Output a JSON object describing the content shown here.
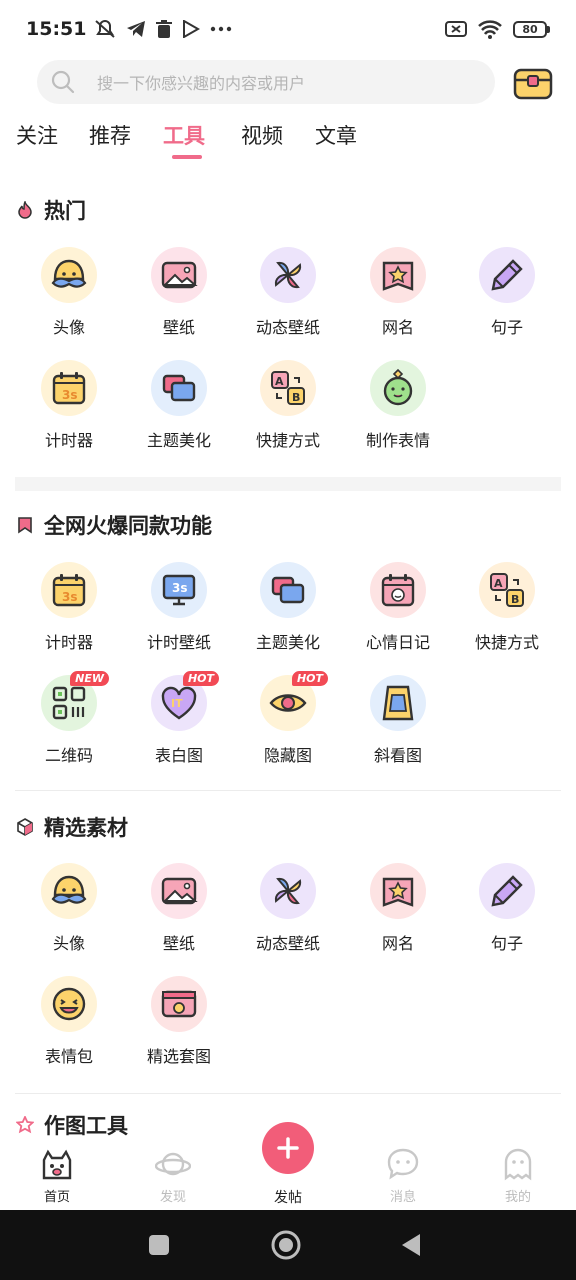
{
  "status_bar": {
    "time": "15:51",
    "battery": "80"
  },
  "search": {
    "placeholder": "搜一下你感兴趣的内容或用户"
  },
  "tabs": [
    {
      "label": "关注"
    },
    {
      "label": "推荐"
    },
    {
      "label": "工具",
      "active": true
    },
    {
      "label": "视频"
    },
    {
      "label": "文章"
    }
  ],
  "sections": {
    "hot": {
      "title": "热门",
      "items": [
        {
          "label": "头像",
          "icon": "mustache-face-icon"
        },
        {
          "label": "壁纸",
          "icon": "picture-icon"
        },
        {
          "label": "动态壁纸",
          "icon": "pinwheel-icon"
        },
        {
          "label": "网名",
          "icon": "star-card-icon"
        },
        {
          "label": "句子",
          "icon": "pencil-icon"
        },
        {
          "label": "计时器",
          "icon": "calendar-3s-icon"
        },
        {
          "label": "主题美化",
          "icon": "layers-icon"
        },
        {
          "label": "快捷方式",
          "icon": "ab-swap-icon"
        },
        {
          "label": "制作表情",
          "icon": "emoji-maker-icon"
        }
      ]
    },
    "viral": {
      "title": "全网火爆同款功能",
      "items": [
        {
          "label": "计时器",
          "icon": "calendar-3s-icon"
        },
        {
          "label": "计时壁纸",
          "icon": "monitor-3s-icon"
        },
        {
          "label": "主题美化",
          "icon": "layers-icon"
        },
        {
          "label": "心情日记",
          "icon": "mood-calendar-icon"
        },
        {
          "label": "快捷方式",
          "icon": "ab-swap-icon"
        },
        {
          "label": "二维码",
          "icon": "qrcode-icon",
          "badge": "NEW"
        },
        {
          "label": "表白图",
          "icon": "heart-letter-icon",
          "badge": "HOT"
        },
        {
          "label": "隐藏图",
          "icon": "eye-icon",
          "badge": "HOT"
        },
        {
          "label": "斜看图",
          "icon": "tilted-card-icon"
        }
      ]
    },
    "materials": {
      "title": "精选素材",
      "items": [
        {
          "label": "头像",
          "icon": "mustache-face-icon"
        },
        {
          "label": "壁纸",
          "icon": "picture-icon"
        },
        {
          "label": "动态壁纸",
          "icon": "pinwheel-icon"
        },
        {
          "label": "网名",
          "icon": "star-card-icon"
        },
        {
          "label": "句子",
          "icon": "pencil-icon"
        },
        {
          "label": "表情包",
          "icon": "laughing-face-icon"
        },
        {
          "label": "精选套图",
          "icon": "photo-frame-icon"
        }
      ]
    },
    "tools": {
      "title": "作图工具"
    }
  },
  "bottom_nav": [
    {
      "label": "首页",
      "active": true
    },
    {
      "label": "发现"
    },
    {
      "label": "发帖"
    },
    {
      "label": "消息"
    },
    {
      "label": "我的"
    }
  ],
  "colors": {
    "accent": "#f06b8a",
    "post_button": "#f25d79",
    "badge": "#f24a55"
  }
}
